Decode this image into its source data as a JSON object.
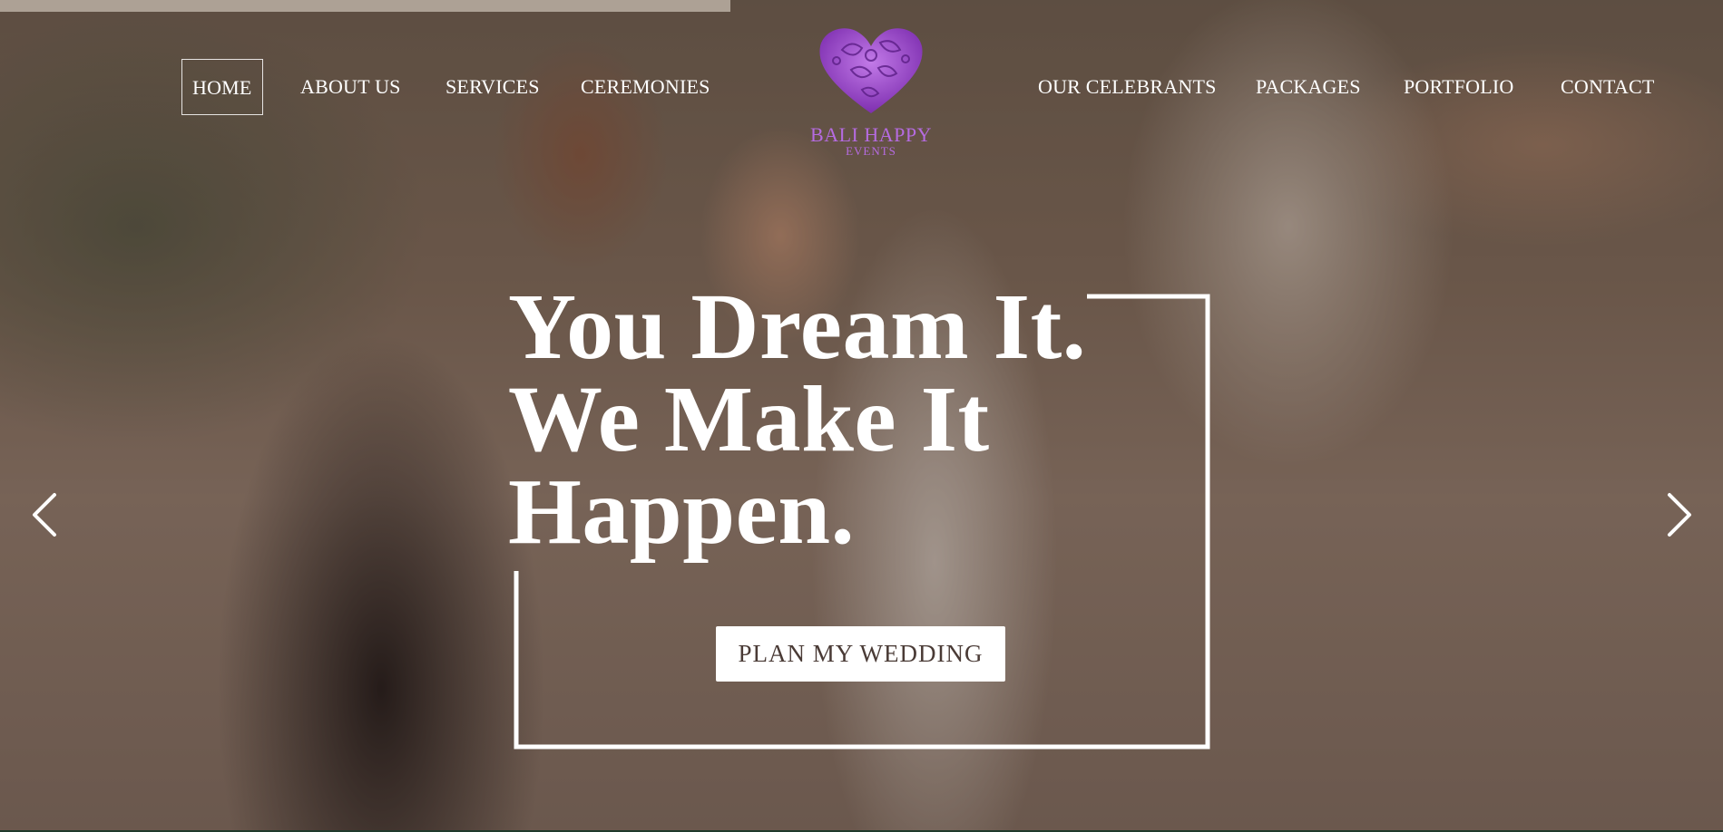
{
  "slider": {
    "progress": 0.424
  },
  "nav": {
    "left": [
      {
        "label": "HOME",
        "active": true
      },
      {
        "label": "ABOUT US"
      },
      {
        "label": "SERVICES"
      },
      {
        "label": "CEREMONIES"
      }
    ],
    "right": [
      {
        "label": "OUR CELEBRANTS"
      },
      {
        "label": "PACKAGES"
      },
      {
        "label": "PORTFOLIO"
      },
      {
        "label": "CONTACT"
      }
    ]
  },
  "logo": {
    "name": "BALI HAPPY",
    "sub": "EVENTS",
    "icon": "heart-icon",
    "color": "#b56be0"
  },
  "hero": {
    "headline_lines": [
      "You Dream It.",
      "We Make It",
      "Happen."
    ],
    "cta_label": "PLAN MY WEDDING",
    "prev_icon": "chevron-left-icon",
    "next_icon": "chevron-right-icon"
  }
}
